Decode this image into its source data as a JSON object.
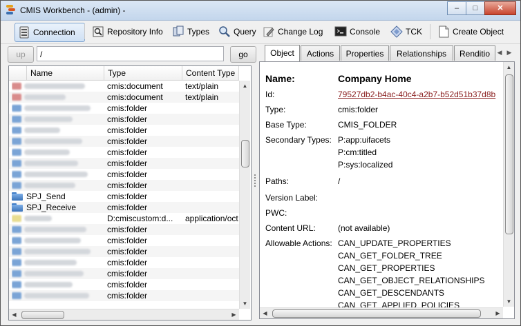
{
  "window": {
    "title": "CMIS Workbench - (admin) -",
    "min": "–",
    "max": "□",
    "close": "✕"
  },
  "toolbar": {
    "connection": "Connection",
    "repository_info": "Repository Info",
    "types": "Types",
    "query": "Query",
    "change_log": "Change Log",
    "console": "Console",
    "tck": "TCK",
    "create_object": "Create Object"
  },
  "path": {
    "up_label": "up",
    "value": "/",
    "go_label": "go"
  },
  "table": {
    "columns": [
      "Name",
      "Type",
      "Content Type"
    ],
    "rows": [
      {
        "name": "",
        "type": "cmis:document",
        "content_type": "text/plain"
      },
      {
        "name": "",
        "type": "cmis:document",
        "content_type": "text/plain"
      },
      {
        "name": "",
        "type": "cmis:folder",
        "content_type": ""
      },
      {
        "name": "",
        "type": "cmis:folder",
        "content_type": ""
      },
      {
        "name": "",
        "type": "cmis:folder",
        "content_type": ""
      },
      {
        "name": "",
        "type": "cmis:folder",
        "content_type": ""
      },
      {
        "name": "",
        "type": "cmis:folder",
        "content_type": ""
      },
      {
        "name": "",
        "type": "cmis:folder",
        "content_type": ""
      },
      {
        "name": "",
        "type": "cmis:folder",
        "content_type": ""
      },
      {
        "name": "",
        "type": "cmis:folder",
        "content_type": ""
      },
      {
        "name": "SPJ_Send",
        "type": "cmis:folder",
        "content_type": ""
      },
      {
        "name": "SPJ_Receive",
        "type": "cmis:folder",
        "content_type": ""
      },
      {
        "name": "",
        "type": "D:cmiscustom:d...",
        "content_type": "application/oct"
      },
      {
        "name": "",
        "type": "cmis:folder",
        "content_type": ""
      },
      {
        "name": "",
        "type": "cmis:folder",
        "content_type": ""
      },
      {
        "name": "",
        "type": "cmis:folder",
        "content_type": ""
      },
      {
        "name": "",
        "type": "cmis:folder",
        "content_type": ""
      },
      {
        "name": "",
        "type": "cmis:folder",
        "content_type": ""
      },
      {
        "name": "",
        "type": "cmis:folder",
        "content_type": ""
      },
      {
        "name": "",
        "type": "cmis:folder",
        "content_type": ""
      }
    ]
  },
  "tabs": [
    "Object",
    "Actions",
    "Properties",
    "Relationships",
    "Renditio"
  ],
  "object": {
    "name_label": "Name:",
    "name_value": "Company Home",
    "id_label": "Id:",
    "id_value": "79527db2-b4ac-40c4-a2b7-b52d51b37d8b",
    "type_label": "Type:",
    "type_value": "cmis:folder",
    "base_type_label": "Base Type:",
    "base_type_value": "CMIS_FOLDER",
    "secondary_types_label": "Secondary Types:",
    "secondary_types": [
      "P:app:uifacets",
      "P:cm:titled",
      "P:sys:localized"
    ],
    "paths_label": "Paths:",
    "paths_value": "/",
    "version_label_label": "Version Label:",
    "pwc_label": "PWC:",
    "content_url_label": "Content URL:",
    "content_url_value": "(not available)",
    "allowable_actions_label": "Allowable Actions:",
    "allowable_actions": [
      "CAN_UPDATE_PROPERTIES",
      "CAN_GET_FOLDER_TREE",
      "CAN_GET_PROPERTIES",
      "CAN_GET_OBJECT_RELATIONSHIPS",
      "CAN_GET_DESCENDANTS",
      "CAN_GET_APPLIED_POLICIES"
    ]
  },
  "icons": {
    "connection": "connection-icon",
    "repository_info": "repository-info-icon",
    "types": "types-icon",
    "query": "magnifier-icon",
    "change_log": "pencil-icon",
    "console": "console-icon",
    "tck": "tck-icon",
    "create_object": "new-document-icon"
  }
}
